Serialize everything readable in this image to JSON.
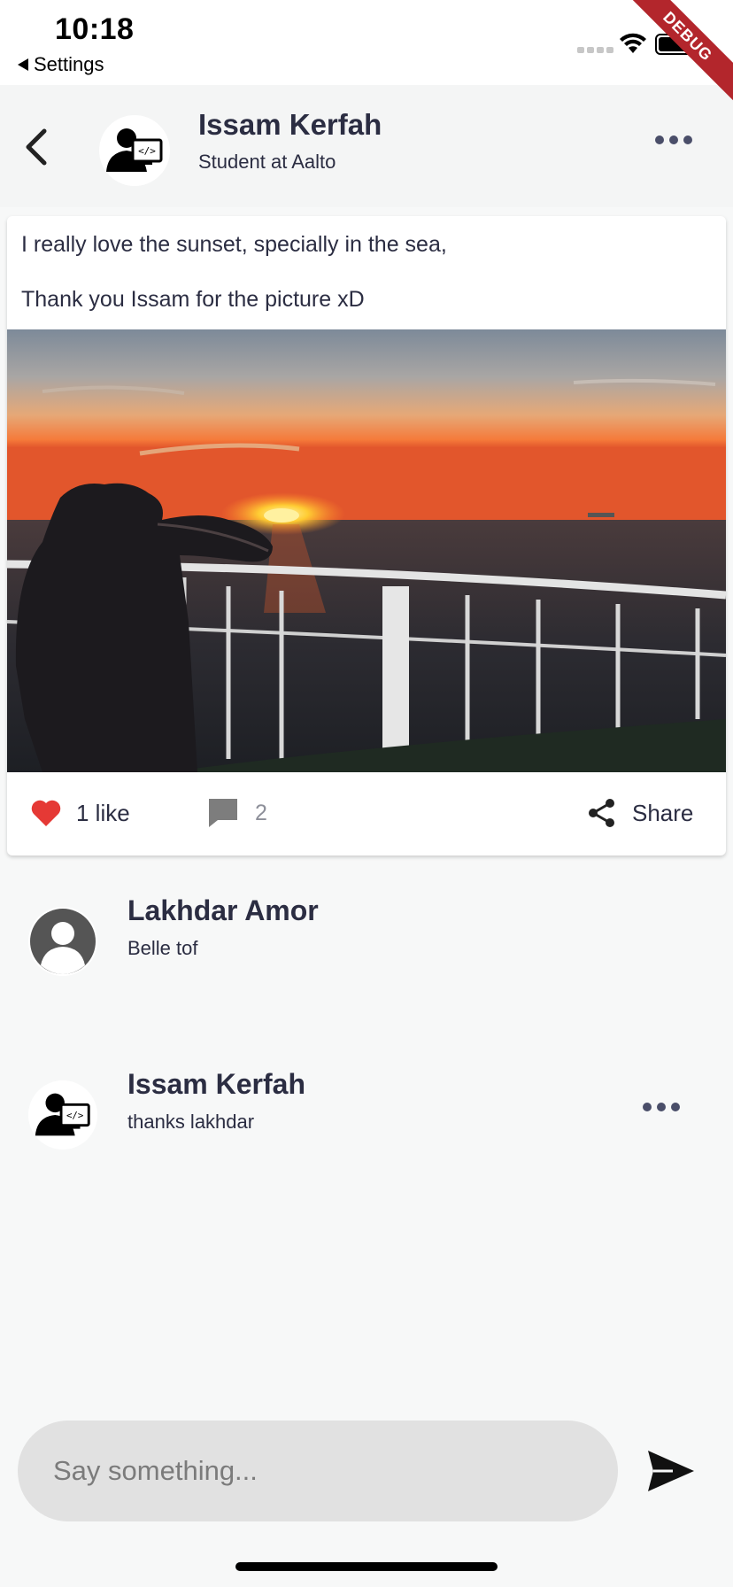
{
  "status_bar": {
    "time": "10:18",
    "back_app_label": "Settings",
    "debug_label": "DEBUG"
  },
  "header": {
    "author_name": "Issam Kerfah",
    "author_subtitle": "Student at Aalto"
  },
  "post": {
    "text_line1": "I really love the sunset, specially in the sea,",
    "text_line2": "Thank you Issam for the picture xD",
    "like_label": "1 like",
    "comment_count": "2",
    "share_label": "Share"
  },
  "comments": [
    {
      "name": "Lakhdar Amor",
      "text": "Belle tof",
      "avatar": "default-person-avatar"
    },
    {
      "name": "Issam Kerfah",
      "text": "thanks lakhdar",
      "avatar": "developer-avatar"
    }
  ],
  "composer": {
    "placeholder": "Say something..."
  },
  "icons": {
    "back": "chevron-left-icon",
    "more": "more-horizontal-icon",
    "like": "heart-icon",
    "comment": "comment-icon",
    "share": "share-icon",
    "send": "send-icon"
  },
  "colors": {
    "like_red": "#e53935",
    "text_dark": "#2b2d42",
    "composer_bg": "#e1e1e1",
    "debug_banner": "#b3262c"
  }
}
